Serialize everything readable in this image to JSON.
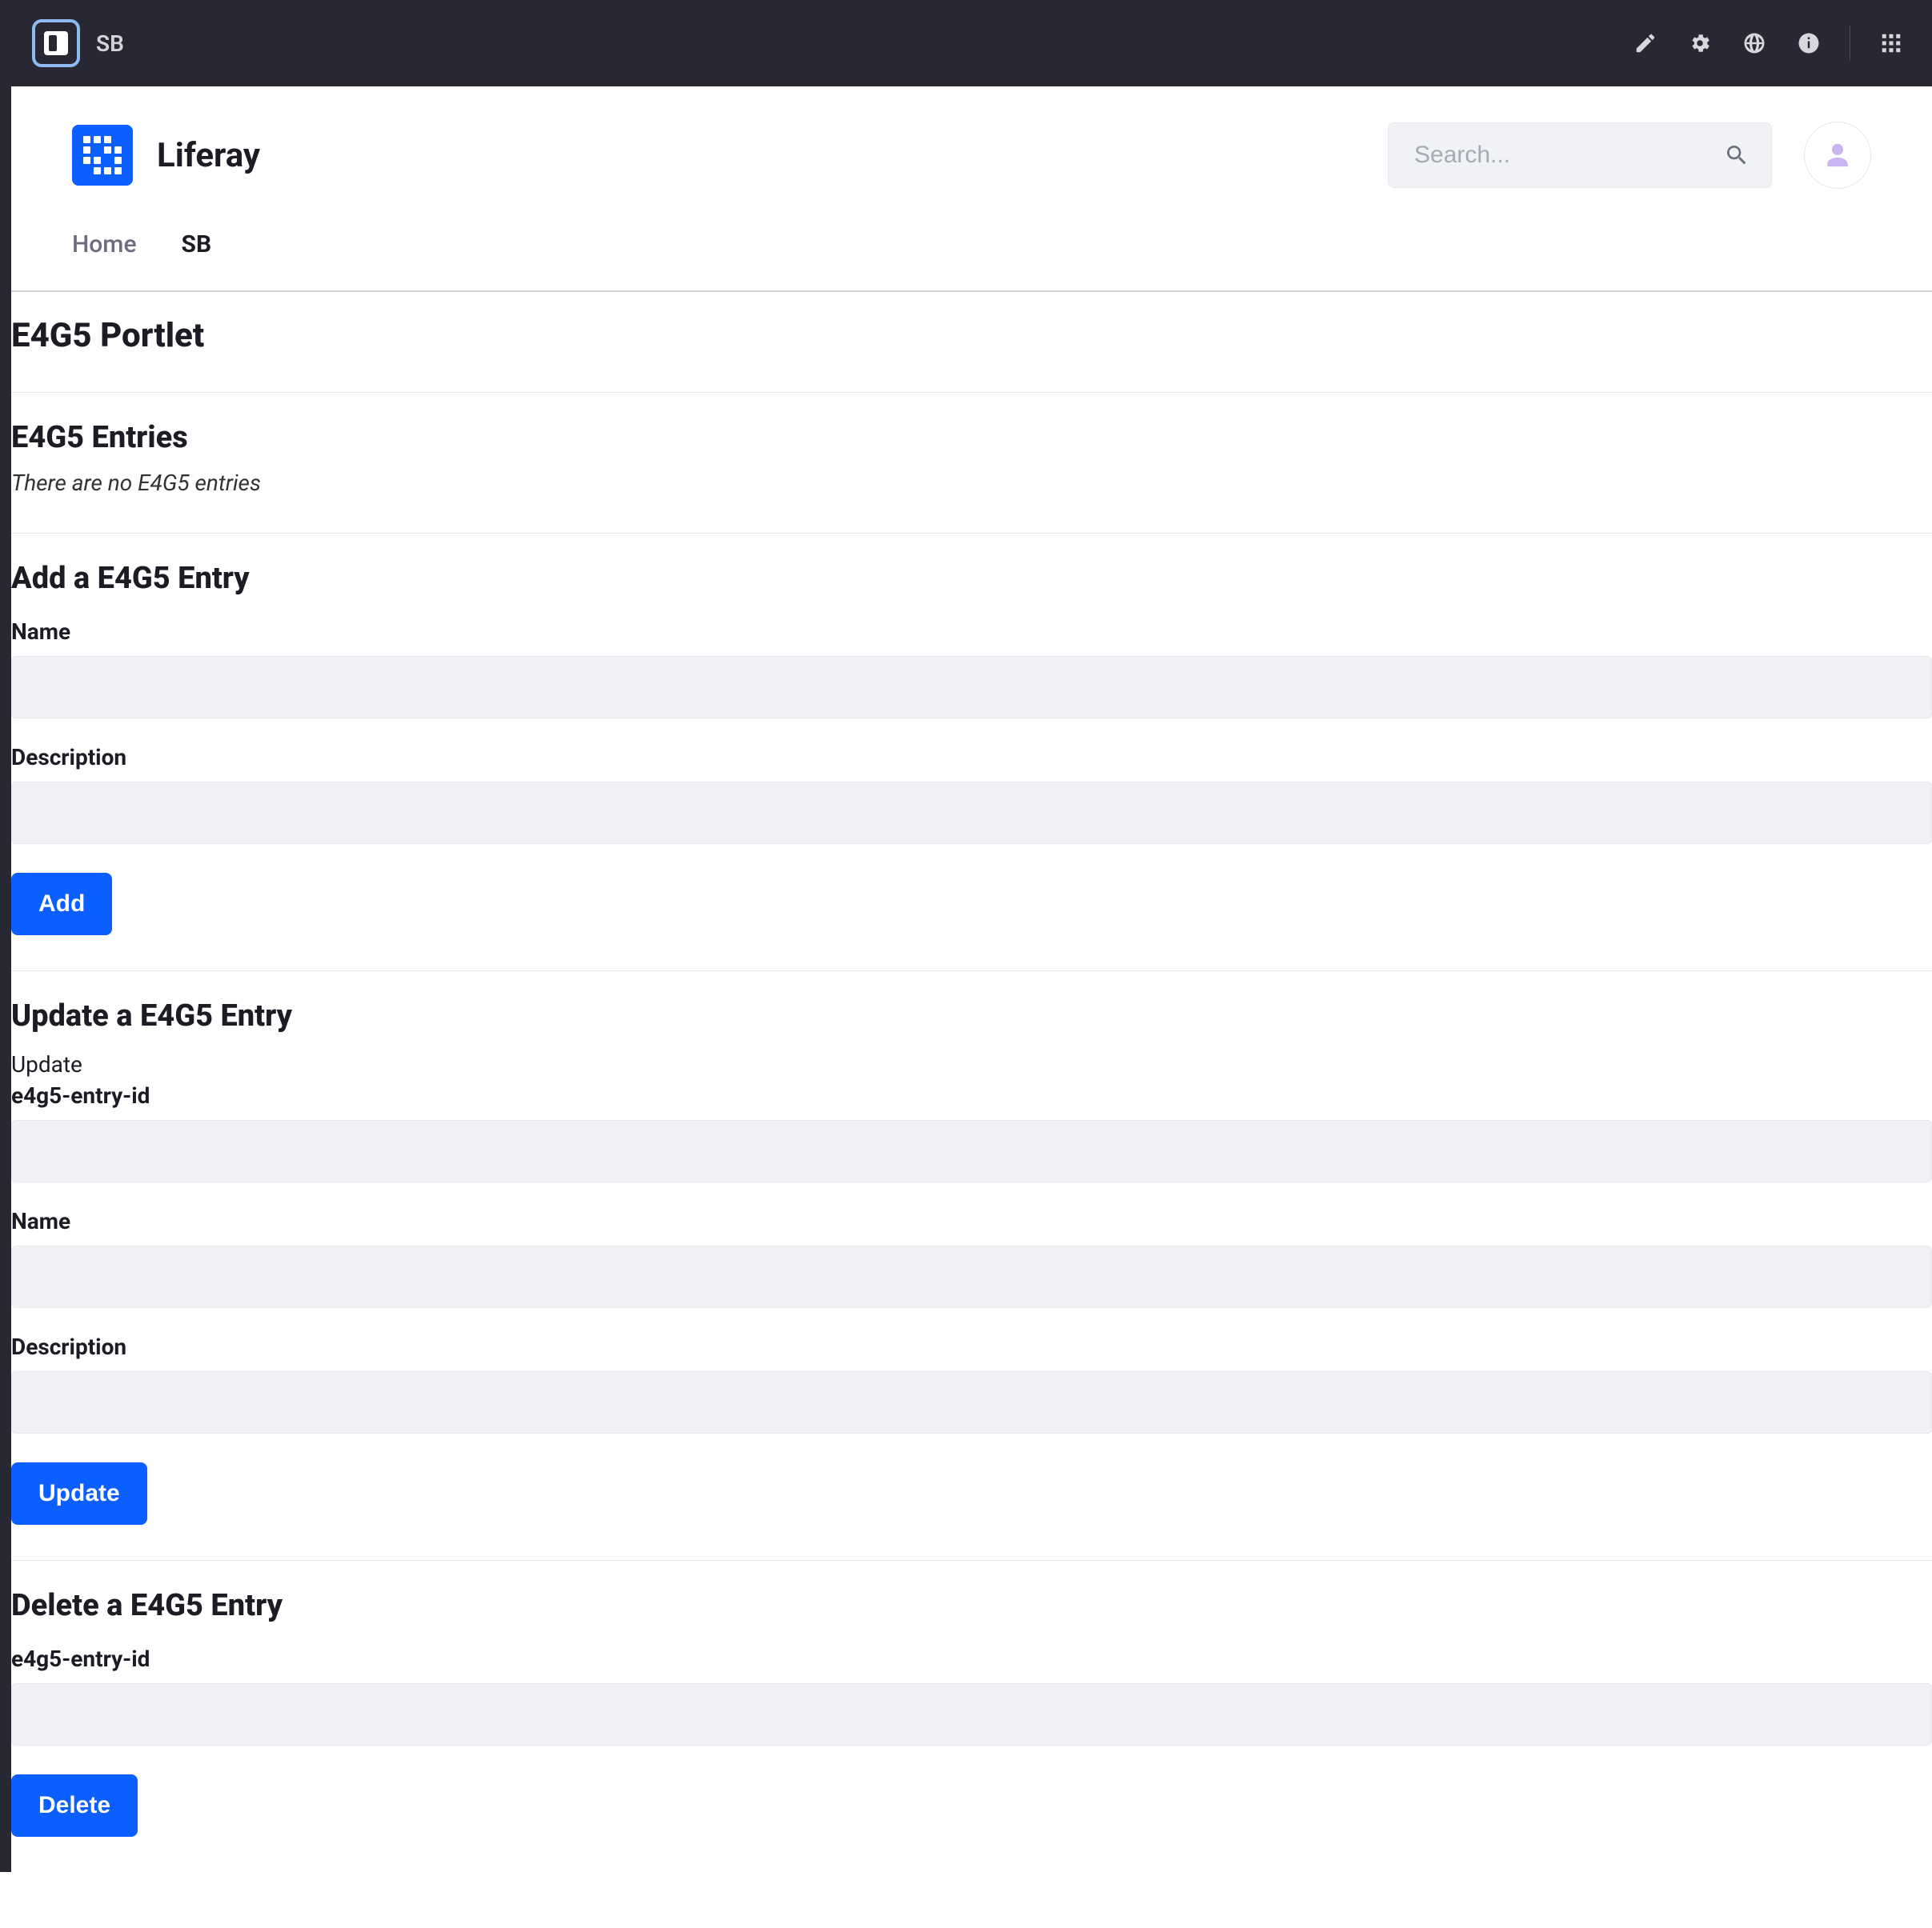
{
  "adminBar": {
    "label": "SB"
  },
  "brand": {
    "name": "Liferay"
  },
  "search": {
    "placeholder": "Search..."
  },
  "nav": {
    "home": "Home",
    "sb": "SB"
  },
  "portlet": {
    "title": "E4G5 Portlet"
  },
  "entries": {
    "heading": "E4G5 Entries",
    "empty": "There are no E4G5 entries"
  },
  "add": {
    "heading": "Add a E4G5 Entry",
    "nameLabel": "Name",
    "descLabel": "Description",
    "button": "Add"
  },
  "update": {
    "heading": "Update a E4G5 Entry",
    "plain": "Update",
    "idLabel": "e4g5-entry-id",
    "nameLabel": "Name",
    "descLabel": "Description",
    "button": "Update"
  },
  "del": {
    "heading": "Delete a E4G5 Entry",
    "idLabel": "e4g5-entry-id",
    "button": "Delete"
  }
}
